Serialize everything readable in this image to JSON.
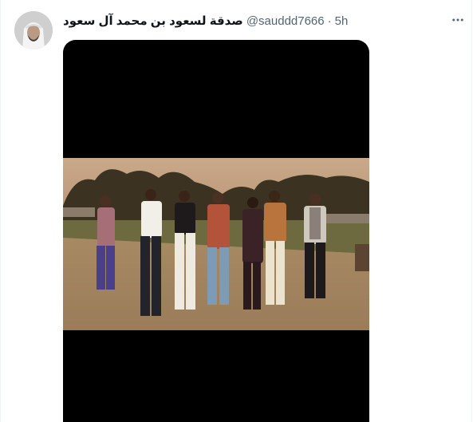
{
  "tweet": {
    "author": {
      "display_name": "صدقة لسعود بن محمد آل سعود",
      "handle": "@sauddd7666",
      "separator": "·",
      "time": "5h"
    },
    "more_icon": "more-horizontal-icon",
    "media": {
      "type": "photo",
      "background": "#000000"
    }
  },
  "colors": {
    "text_primary": "#0f1419",
    "text_secondary": "#536471",
    "border": "#eff3f4"
  }
}
